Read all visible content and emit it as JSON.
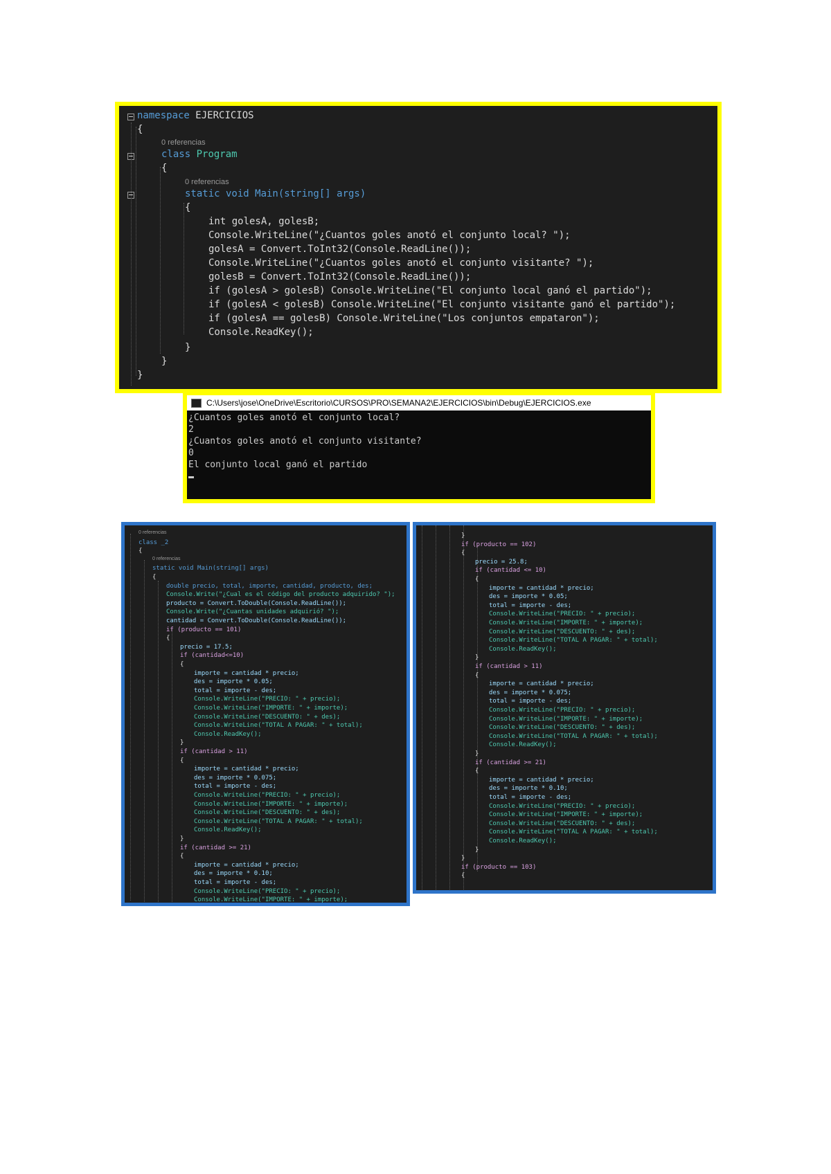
{
  "editor1": {
    "refs": "0 referencias",
    "lines": {
      "namespace_kw": "namespace",
      "namespace_name": "EJERCICIOS",
      "class_kw": "class",
      "class_name": "Program",
      "main_sig": "static void Main(string[] args)",
      "l1": "int golesA, golesB;",
      "l2": "Console.WriteLine(\"¿Cuantos goles anotó el conjunto local? \");",
      "l3": "golesA = Convert.ToInt32(Console.ReadLine());",
      "l4": "Console.WriteLine(\"¿Cuantos goles anotó el conjunto visitante? \");",
      "l5": "golesB = Convert.ToInt32(Console.ReadLine());",
      "l6": "if (golesA > golesB) Console.WriteLine(\"El conjunto local ganó el partido\");",
      "l7": "if (golesA < golesB) Console.WriteLine(\"El conjunto visitante ganó el partido\");",
      "l8": "if (golesA == golesB) Console.WriteLine(\"Los conjuntos empataron\");",
      "l9": "Console.ReadKey();"
    }
  },
  "console": {
    "title": "C:\\Users\\jose\\OneDrive\\Escritorio\\CURSOS\\PRO\\SEMANA2\\EJERCICIOS\\bin\\Debug\\EJERCICIOS.exe",
    "lines": [
      "¿Cuantos goles anotó el conjunto local?",
      "2",
      "¿Cuantos goles anotó el conjunto visitante?",
      "0",
      "El conjunto local ganó el partido"
    ]
  },
  "editor2": {
    "lines": [
      "0 referencias",
      "class _2",
      "{",
      "0 referencias",
      "static void Main(string[] args)",
      "{",
      "double precio, total, importe, cantidad, producto, des;",
      "Console.Write(\"¿Cual es el código del producto adquirido? \");",
      "producto = Convert.ToDouble(Console.ReadLine());",
      "Console.Write(\"¿Cuantas unidades adquirió? \");",
      "cantidad = Convert.ToDouble(Console.ReadLine());",
      "if (producto == 101)",
      "{",
      "precio = 17.5;",
      "if (cantidad<=10)",
      "{",
      "importe = cantidad * precio;",
      "des = importe * 0.05;",
      "total = importe - des;",
      "Console.WriteLine(\"PRECIO: \" + precio);",
      "Console.WriteLine(\"IMPORTE: \" + importe);",
      "Console.WriteLine(\"DESCUENTO: \" + des);",
      "Console.WriteLine(\"TOTAL A PAGAR: \" + total);",
      "Console.ReadKey();",
      "}",
      "if (cantidad > 11)",
      "{",
      "importe = cantidad * precio;",
      "des = importe * 0.075;",
      "total = importe - des;",
      "Console.WriteLine(\"PRECIO: \" + precio);",
      "Console.WriteLine(\"IMPORTE: \" + importe);",
      "Console.WriteLine(\"DESCUENTO: \" + des);",
      "Console.WriteLine(\"TOTAL A PAGAR: \" + total);",
      "Console.ReadKey();",
      "}",
      "if (cantidad >= 21)",
      "{",
      "importe = cantidad * precio;",
      "des = importe * 0.10;",
      "total = importe - des;",
      "Console.WriteLine(\"PRECIO: \" + precio);",
      "Console.WriteLine(\"IMPORTE: \" + importe);"
    ],
    "indents": [
      0,
      0,
      0,
      1,
      1,
      1,
      2,
      2,
      2,
      2,
      2,
      2,
      2,
      3,
      3,
      3,
      4,
      4,
      4,
      4,
      4,
      4,
      4,
      4,
      3,
      3,
      3,
      4,
      4,
      4,
      4,
      4,
      4,
      4,
      4,
      3,
      3,
      3,
      4,
      4,
      4,
      4,
      4
    ]
  },
  "editor3": {
    "lines": [
      "}",
      "if (producto == 102)",
      "{",
      "precio = 25.8;",
      "if (cantidad <= 10)",
      "{",
      "importe = cantidad * precio;",
      "des = importe * 0.05;",
      "total = importe - des;",
      "Console.WriteLine(\"PRECIO: \" + precio);",
      "Console.WriteLine(\"IMPORTE: \" + importe);",
      "Console.WriteLine(\"DESCUENTO: \" + des);",
      "Console.WriteLine(\"TOTAL A PAGAR: \" + total);",
      "Console.ReadKey();",
      "}",
      "if (cantidad > 11)",
      "{",
      "importe = cantidad * precio;",
      "des = importe * 0.075;",
      "total = importe - des;",
      "Console.WriteLine(\"PRECIO: \" + precio);",
      "Console.WriteLine(\"IMPORTE: \" + importe);",
      "Console.WriteLine(\"DESCUENTO: \" + des);",
      "Console.WriteLine(\"TOTAL A PAGAR: \" + total);",
      "Console.ReadKey();",
      "}",
      "if (cantidad >= 21)",
      "{",
      "importe = cantidad * precio;",
      "des = importe * 0.10;",
      "total = importe - des;",
      "Console.WriteLine(\"PRECIO: \" + precio);",
      "Console.WriteLine(\"IMPORTE: \" + importe);",
      "Console.WriteLine(\"DESCUENTO: \" + des);",
      "Console.WriteLine(\"TOTAL A PAGAR: \" + total);",
      "Console.ReadKey();",
      "}",
      "}",
      "if (producto == 103)",
      "{"
    ],
    "indents": [
      3,
      3,
      3,
      4,
      4,
      4,
      5,
      5,
      5,
      5,
      5,
      5,
      5,
      5,
      4,
      4,
      4,
      5,
      5,
      5,
      5,
      5,
      5,
      5,
      5,
      4,
      4,
      4,
      5,
      5,
      5,
      5,
      5,
      5,
      5,
      5,
      4,
      3,
      3,
      3
    ]
  },
  "colors": {
    "highlight_border": "#ffff00",
    "blue_border": "#2e74c9",
    "editor_bg": "#1e1e1e",
    "console_bg": "#0c0c0c"
  }
}
